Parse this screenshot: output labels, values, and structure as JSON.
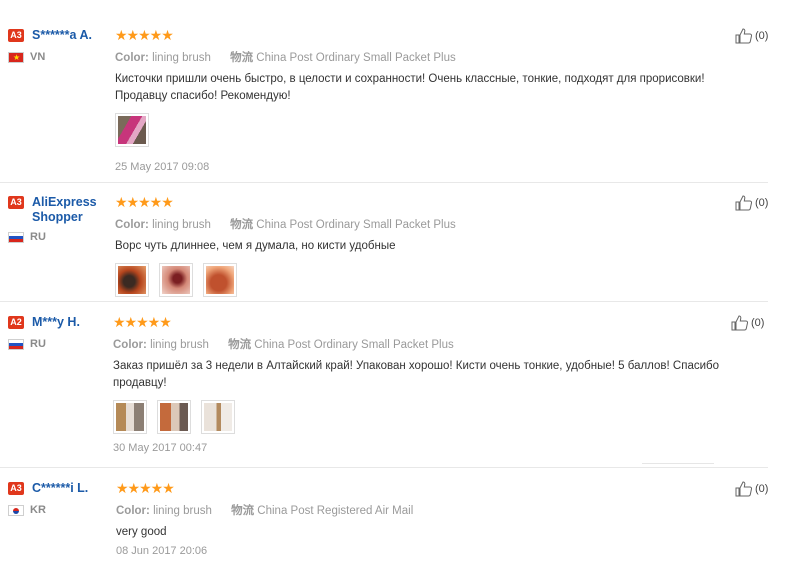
{
  "reviews": [
    {
      "level": "A3",
      "name": "S******a A.",
      "country": "VN",
      "stars": "★★★★★",
      "color_label": "Color:",
      "color_value": "lining brush",
      "shipping_label": "物流",
      "shipping_value": "China Post Ordinary Small Packet Plus",
      "text": "Кисточки пришли очень быстро, в целости и сохранности! Очень классные, тонкие, подходят для прорисовки! Продавцу спасибо! Рекомендую!",
      "date": "25 May 2017 09:08",
      "useful_count": "(0)"
    },
    {
      "level": "A3",
      "name": "AliExpress Shopper",
      "country": "RU",
      "stars": "★★★★★",
      "color_label": "Color:",
      "color_value": "lining brush",
      "shipping_label": "物流",
      "shipping_value": "China Post Ordinary Small Packet Plus",
      "text": "Ворс чуть длиннее, чем я думала, но кисти удобные",
      "date": "",
      "useful_count": "(0)"
    },
    {
      "level": "A2",
      "name": "M***y H.",
      "country": "RU",
      "stars": "★★★★★",
      "color_label": "Color:",
      "color_value": "lining brush",
      "shipping_label": "物流",
      "shipping_value": "China Post Ordinary Small Packet Plus",
      "text": "Заказ пришёл за 3 недели в Алтайский край! Упакован хорошо! Кисти очень тонкие, удобные! 5 баллов! Спасибо продавцу!",
      "date": "30 May 2017 00:47",
      "useful_count": "(0)"
    },
    {
      "level": "A3",
      "name": "C******i L.",
      "country": "KR",
      "stars": "★★★★★",
      "color_label": "Color:",
      "color_value": "lining brush",
      "shipping_label": "物流",
      "shipping_value": "China Post Registered Air Mail",
      "text": "very good",
      "date": "08 Jun 2017 20:06",
      "useful_count": "(0)"
    }
  ],
  "colors": {
    "badge": "#e0371c",
    "username": "#1b5aa8",
    "star": "#ff9a1a",
    "meta": "#9a9a9a"
  },
  "icons": {
    "useful": "thumbs-up-icon"
  }
}
